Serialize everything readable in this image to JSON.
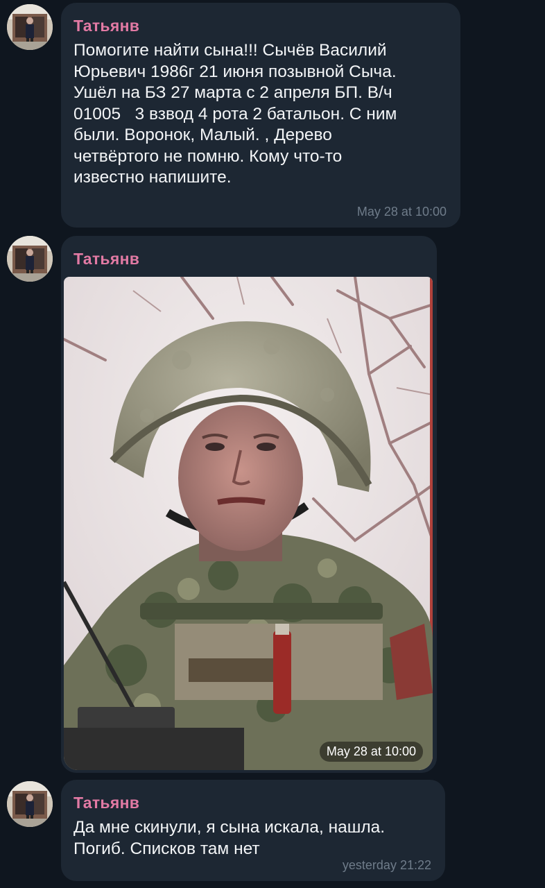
{
  "messages": [
    {
      "sender": "Татьянв",
      "text": "Помогите найти сына!!! Сычёв Василий\nЮрьевич 1986г 21 июня позывной Сыча.\nУшёл на БЗ 27 марта с 2 апреля БП. В/ч\n01005   3 взвод 4 рота 2 батальон. С ним\nбыли. Воронок, Малый. , Дерево\nчетвёртого не помню. Кому что-то\nизвестно напишите.",
      "time": "May 28 at 10:00"
    },
    {
      "sender": "Татьянв",
      "photo": "soldier-photo",
      "time": "May 28 at 10:00"
    },
    {
      "sender": "Татьянв",
      "text": "Да мне скинули, я сына искала, нашла.\nПогиб. Списков там нет",
      "time": "yesterday 21:22"
    }
  ],
  "colors": {
    "background": "#0f161f",
    "bubble": "#1d2733",
    "sender_name": "#e27aa4",
    "text": "#f3f5f7",
    "timestamp": "#6f7c8a"
  }
}
